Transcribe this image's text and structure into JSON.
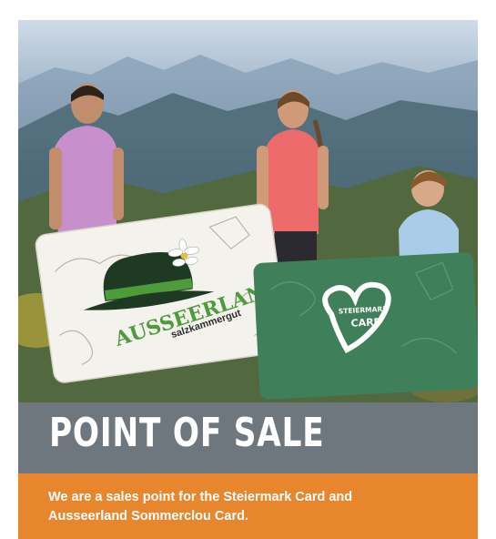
{
  "heading": "POINT OF SALE",
  "description_lines": [
    "We are a sales point for the Steiermark Card and",
    "Ausseerland Sommerclou Card."
  ],
  "cards": {
    "ausseerland": {
      "brand": "AUSSEERLAND",
      "sub": "salzkammergut"
    },
    "steiermark": {
      "line1": "STEIERMARK",
      "line2": "CARD"
    }
  },
  "colors": {
    "title_band": "#6f777e",
    "orange_band": "#e8862d",
    "steiermark_green": "#3f7f5a",
    "ausseerland_green": "#4e9b3b"
  }
}
